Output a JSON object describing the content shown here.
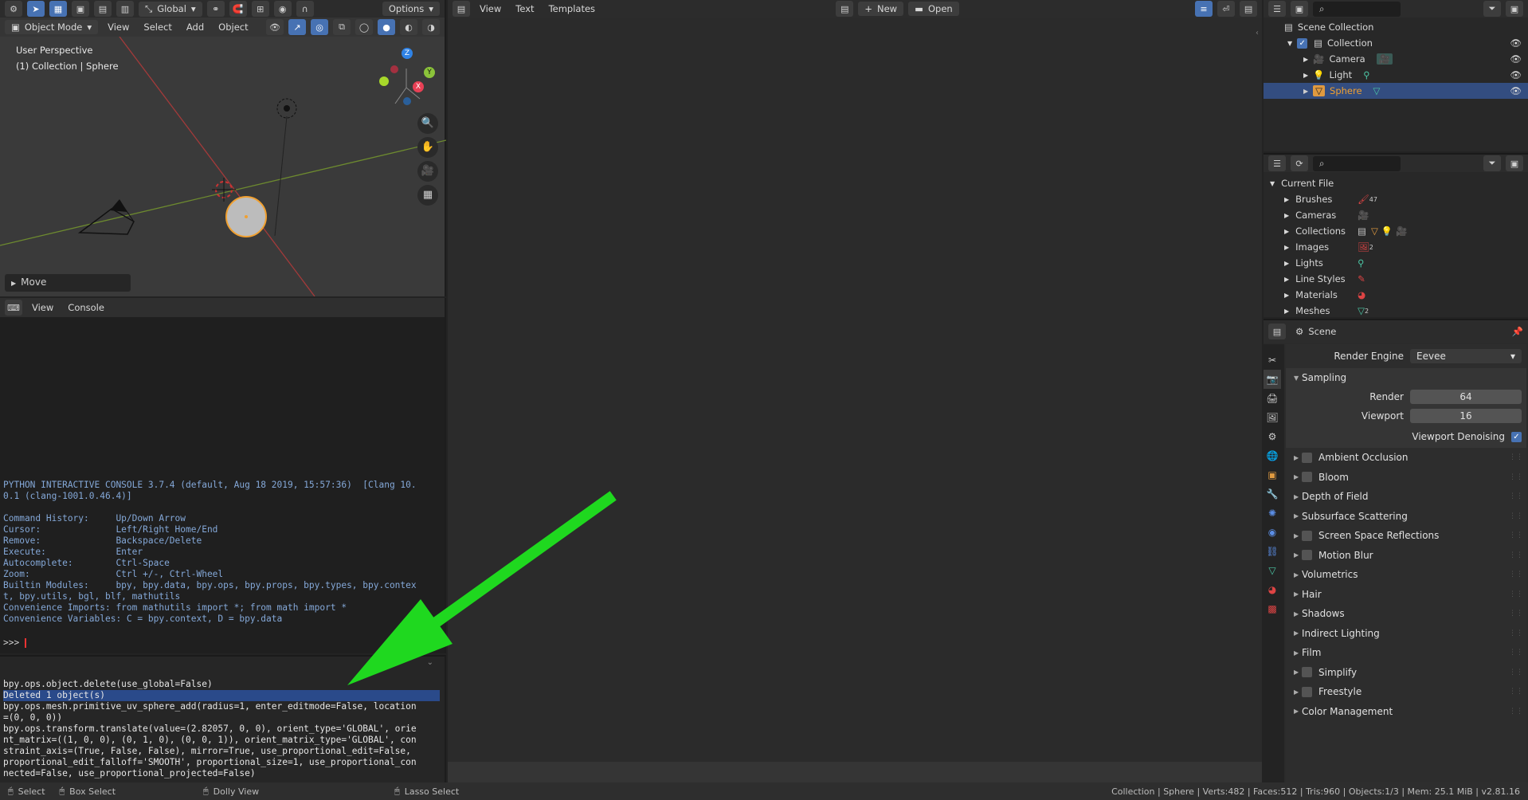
{
  "viewport": {
    "mode": "Object Mode",
    "menus": [
      "View",
      "Select",
      "Add",
      "Object"
    ],
    "transform": "Global",
    "options": "Options",
    "perspective": "User Perspective",
    "collection": "(1) Collection | Sphere",
    "operator_panel": "Move",
    "axis_x": "X",
    "axis_y": "Y",
    "axis_z": "Z"
  },
  "text_editor": {
    "menus": [
      "View",
      "Text",
      "Templates"
    ],
    "new_label": "New",
    "open_label": "Open"
  },
  "console": {
    "menus": [
      "View",
      "Console"
    ],
    "lines": [
      "PYTHON INTERACTIVE CONSOLE 3.7.4 (default, Aug 18 2019, 15:57:36)  [Clang 10.",
      "0.1 (clang-1001.0.46.4)]",
      "",
      "Command History:     Up/Down Arrow",
      "Cursor:              Left/Right Home/End",
      "Remove:              Backspace/Delete",
      "Execute:             Enter",
      "Autocomplete:        Ctrl-Space",
      "Zoom:                Ctrl +/-, Ctrl-Wheel",
      "Builtin Modules:     bpy, bpy.data, bpy.ops, bpy.props, bpy.types, bpy.contex",
      "t, bpy.utils, bgl, blf, mathutils",
      "Convenience Imports: from mathutils import *; from math import *",
      "Convenience Variables: C = bpy.context, D = bpy.data"
    ],
    "prompt": ">>> "
  },
  "info": {
    "lines": [
      "bpy.ops.object.delete(use_global=False)",
      "Deleted 1 object(s)",
      "bpy.ops.mesh.primitive_uv_sphere_add(radius=1, enter_editmode=False, location",
      "=(0, 0, 0))",
      "bpy.ops.transform.translate(value=(2.82057, 0, 0), orient_type='GLOBAL', orie",
      "nt_matrix=((1, 0, 0), (0, 1, 0), (0, 0, 1)), orient_matrix_type='GLOBAL', con",
      "straint_axis=(True, False, False), mirror=True, use_proportional_edit=False,",
      "proportional_edit_falloff='SMOOTH', proportional_size=1, use_proportional_con",
      "nected=False, use_proportional_projected=False)"
    ],
    "highlight_index": 1
  },
  "outliner": {
    "scene_collection": "Scene Collection",
    "items": [
      {
        "label": "Collection",
        "level": 1
      },
      {
        "label": "Camera",
        "level": 2
      },
      {
        "label": "Light",
        "level": 2
      },
      {
        "label": "Sphere",
        "level": 2
      }
    ]
  },
  "file_browser": {
    "root": "Current File",
    "items": [
      "Brushes",
      "Cameras",
      "Collections",
      "Images",
      "Lights",
      "Line Styles",
      "Materials",
      "Meshes"
    ],
    "brushes_count": "47",
    "images_count": "2",
    "meshes_count": "2"
  },
  "properties": {
    "context": "Scene",
    "render_engine_label": "Render Engine",
    "render_engine_value": "Eevee",
    "sampling_label": "Sampling",
    "render_label": "Render",
    "render_value": "64",
    "viewport_label": "Viewport",
    "viewport_value": "16",
    "denoise_label": "Viewport Denoising",
    "panels": [
      {
        "label": "Ambient Occlusion",
        "checkbox": true
      },
      {
        "label": "Bloom",
        "checkbox": true
      },
      {
        "label": "Depth of Field",
        "checkbox": false
      },
      {
        "label": "Subsurface Scattering",
        "checkbox": false
      },
      {
        "label": "Screen Space Reflections",
        "checkbox": true
      },
      {
        "label": "Motion Blur",
        "checkbox": true
      },
      {
        "label": "Volumetrics",
        "checkbox": false
      },
      {
        "label": "Hair",
        "checkbox": false
      },
      {
        "label": "Shadows",
        "checkbox": false
      },
      {
        "label": "Indirect Lighting",
        "checkbox": false
      },
      {
        "label": "Film",
        "checkbox": false
      },
      {
        "label": "Simplify",
        "checkbox": true
      },
      {
        "label": "Freestyle",
        "checkbox": true
      },
      {
        "label": "Color Management",
        "checkbox": false
      }
    ]
  },
  "statusbar": {
    "select": "Select",
    "box_select": "Box Select",
    "dolly": "Dolly View",
    "lasso": "Lasso Select",
    "stats": "Collection | Sphere | Verts:482 | Faces:512 | Tris:960 | Objects:1/3 | Mem: 25.1 MiB | v2.81.16"
  },
  "colors": {
    "accent": "#4772b3",
    "arrow": "#1fd81f",
    "sphere_selected": "#f0a030"
  }
}
